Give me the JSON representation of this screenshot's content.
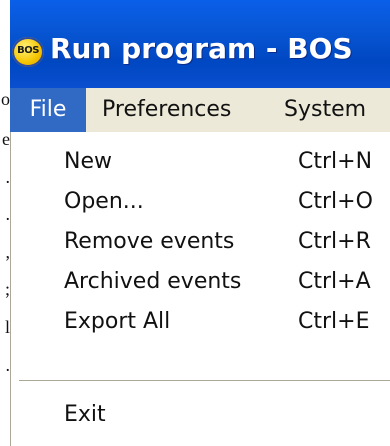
{
  "window": {
    "title": "Run program - BOS",
    "logo_text": "BOS"
  },
  "page_edge_chars": [
    "o",
    "e",
    ".",
    ".",
    ",",
    ";",
    "l",
    "."
  ],
  "menubar": {
    "items": [
      {
        "label": "File",
        "active": true
      },
      {
        "label": "Preferences",
        "active": false
      },
      {
        "label": "System",
        "active": false
      }
    ]
  },
  "file_menu": {
    "items": [
      {
        "label": "New",
        "shortcut": "Ctrl+N"
      },
      {
        "label": "Open...",
        "shortcut": "Ctrl+O"
      },
      {
        "label": "Remove events",
        "shortcut": "Ctrl+R"
      },
      {
        "label": "Archived events",
        "shortcut": "Ctrl+A"
      },
      {
        "label": "Export All",
        "shortcut": "Ctrl+E"
      }
    ],
    "exit_label": "Exit"
  },
  "colors": {
    "titlebar": "#0856d4",
    "menu_highlight": "#316ac5",
    "menu_background": "#ece9d8"
  }
}
